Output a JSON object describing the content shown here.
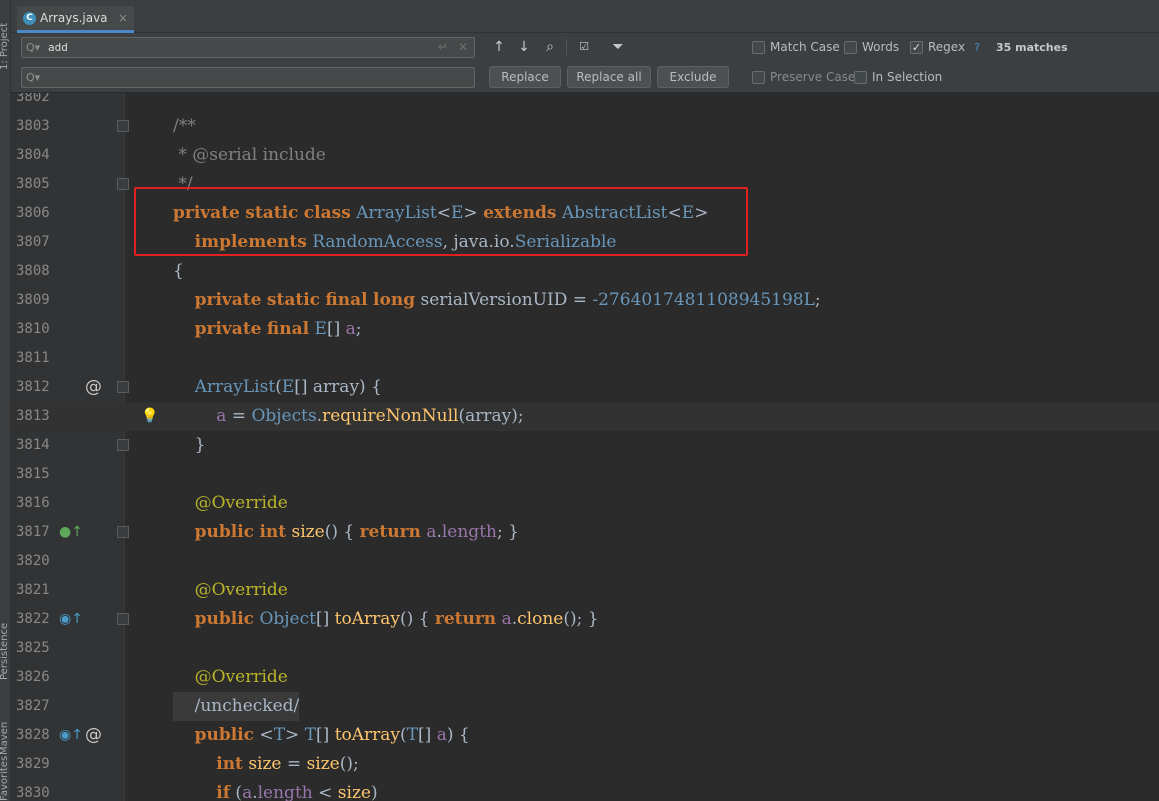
{
  "left_strip": {
    "labels": [
      "1: Project",
      "Persistence",
      "Maven",
      "Favorites"
    ]
  },
  "tab": {
    "icon": "class-icon",
    "title": "Arrays.java",
    "close": "×"
  },
  "find": {
    "search_value": "add",
    "replace_value": "",
    "replace_label": "Replace",
    "replace_all_label": "Replace all",
    "exclude_label": "Exclude",
    "match_case_label": "Match Case",
    "words_label": "Words",
    "regex_label": "Regex",
    "regex_help": "?",
    "match_count": "35 matches",
    "preserve_case_label": "Preserve Case",
    "in_selection_label": "In Selection",
    "match_case_checked": false,
    "words_checked": false,
    "regex_checked": true
  },
  "editor": {
    "lines": [
      {
        "n": "3802",
        "code": ""
      },
      {
        "n": "3803",
        "code": "/**"
      },
      {
        "n": "3804",
        "code": " * @serial include"
      },
      {
        "n": "3805",
        "code": " */"
      },
      {
        "n": "3806",
        "code": "private static class ArrayList<E> extends AbstractList<E>"
      },
      {
        "n": "3807",
        "code": "    implements RandomAccess, java.io.Serializable"
      },
      {
        "n": "3808",
        "code": "{"
      },
      {
        "n": "3809",
        "code": "    private static final long serialVersionUID = -2764017481108945198L;"
      },
      {
        "n": "3810",
        "code": "    private final E[] a;"
      },
      {
        "n": "3811",
        "code": ""
      },
      {
        "n": "3812",
        "code": "    ArrayList(E[] array) {"
      },
      {
        "n": "3813",
        "code": "        a = Objects.requireNonNull(array);"
      },
      {
        "n": "3814",
        "code": "    }"
      },
      {
        "n": "3815",
        "code": ""
      },
      {
        "n": "3816",
        "code": "    @Override"
      },
      {
        "n": "3817",
        "code": "    public int size() { return a.length; }"
      },
      {
        "n": "3820",
        "code": ""
      },
      {
        "n": "3821",
        "code": "    @Override"
      },
      {
        "n": "3822",
        "code": "    public Object[] toArray() { return a.clone(); }"
      },
      {
        "n": "3825",
        "code": ""
      },
      {
        "n": "3826",
        "code": "    @Override"
      },
      {
        "n": "3827",
        "code": "    /unchecked/"
      },
      {
        "n": "3828",
        "code": "    public <T> T[] toArray(T[] a) {"
      },
      {
        "n": "3829",
        "code": "        int size = size();"
      },
      {
        "n": "3830",
        "code": "        if (a.length < size)"
      }
    ]
  }
}
